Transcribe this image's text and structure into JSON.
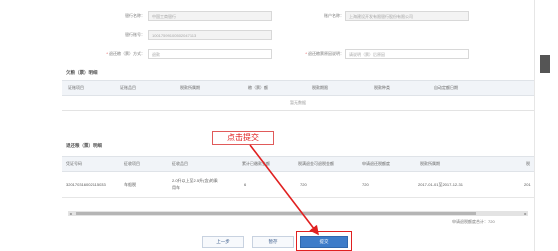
{
  "form": {
    "row1": {
      "bank_label": "银行名称：",
      "bank_value": "中国工商银行",
      "account_name_label": "账户名称：",
      "account_name_value": "上海建设开发有限银行股份有限公司"
    },
    "row2": {
      "bank_account_label": "银行账号：",
      "bank_account_value": "10017599100502047113"
    },
    "row3": {
      "method_label": "退还粮（票）方式：",
      "method_value": "退款",
      "reason_label": "退还粮票原因说明：",
      "reason_placeholder": "请说明（票）后原因"
    }
  },
  "sections": {
    "top": {
      "title": "欠粮（票）明细",
      "headers": [
        "证账项目",
        "证账品目",
        "税款所属期",
        "粮（票）额",
        "税款期限",
        "税款种类",
        "自动定额日期"
      ],
      "empty_text": "暂无数据"
    },
    "bottom": {
      "title": "退还粮（票）明细",
      "headers": [
        "凭证号码",
        "征收项目",
        "征收品目",
        "累计已缴款金额",
        "税满退金可退税金额",
        "申请退还税额度",
        "税款所属期",
        "税"
      ],
      "rows": [
        {
          "voucher": "320170316002115033",
          "item": "车船税",
          "category": [
            "2.0升以上至2.5升(含)的乘",
            "用车"
          ],
          "paid": "6",
          "refundable": "720",
          "apply": "720",
          "period": "2017-01-01至2017-12-31",
          "extra": "201"
        }
      ],
      "note": "申请退税额度合计：720"
    }
  },
  "buttons": {
    "prev": "上一步",
    "save": "暂存",
    "submit": "提交"
  },
  "annotation": {
    "text": "点击提交"
  },
  "colors": {
    "accent": "#3d7cc9",
    "annotation": "#e02020"
  }
}
